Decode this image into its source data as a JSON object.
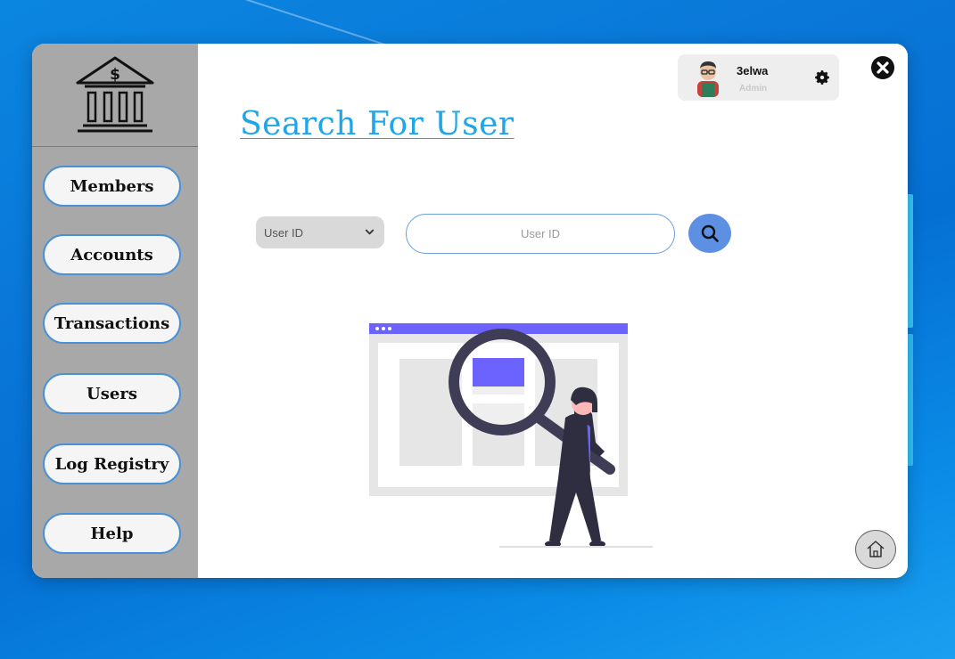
{
  "app": {
    "logo_icon": "bank-icon"
  },
  "sidebar": {
    "items": [
      {
        "label": "Members",
        "icon": null
      },
      {
        "label": "Accounts",
        "icon": null
      },
      {
        "label": "Transactions",
        "icon": null
      },
      {
        "label": "Users",
        "icon": null
      },
      {
        "label": "Log Registry",
        "icon": null
      },
      {
        "label": "Help",
        "icon": null
      }
    ]
  },
  "header": {
    "title": "Search For User"
  },
  "profile": {
    "name": "3elwa",
    "role": "Admin",
    "avatar_icon": "avatar-icon",
    "settings_icon": "gear-icon"
  },
  "window_controls": {
    "close_icon": "close-icon",
    "home_icon": "home-icon"
  },
  "search": {
    "field_select_value": "User ID",
    "input_value": "",
    "input_placeholder": "User ID",
    "search_icon": "search-icon"
  },
  "colors": {
    "accent": "#1ea6e8",
    "button_border": "#4a90d6",
    "search_button": "#5d8fe3",
    "illustration_purple": "#6c63ff",
    "sidebar_bg": "#a8a8a8"
  }
}
